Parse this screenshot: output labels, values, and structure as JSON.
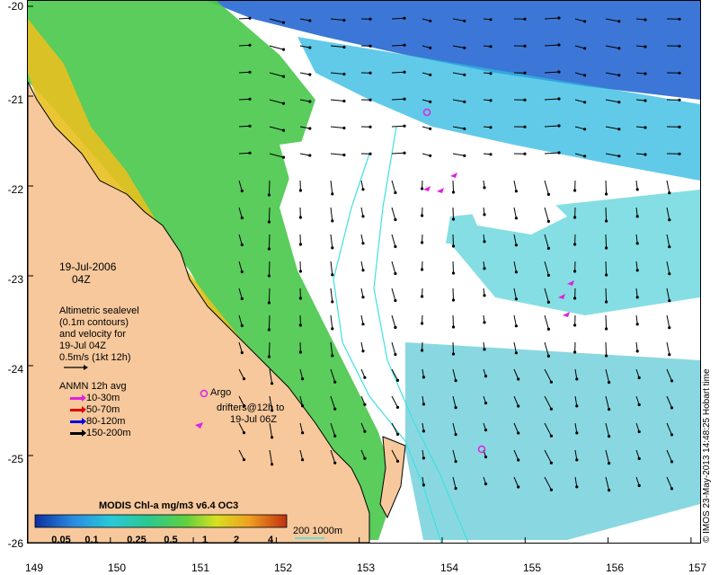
{
  "map": {
    "date_line1": "19-Jul-2006",
    "date_line2": "04Z",
    "lat_labels": [
      "-20",
      "-21",
      "-22",
      "-23",
      "-24",
      "-25",
      "-26"
    ],
    "lon_labels": [
      "149",
      "150",
      "151",
      "152",
      "153",
      "154",
      "155",
      "156",
      "157"
    ],
    "altimetry_text": [
      "Altimetric sealevel",
      "(0.1m contours)",
      "and velocity for",
      "19-Jul 04Z",
      "0.5m/s (1kt 12h)"
    ],
    "anmn_title": "ANMN 12h avg",
    "anmn_items": [
      {
        "label": "10-30m",
        "color": "#e020e0"
      },
      {
        "label": "50-70m",
        "color": "#e00000"
      },
      {
        "label": "80-120m",
        "color": "#0000e0"
      },
      {
        "label": "150-200m",
        "color": "#000000"
      }
    ],
    "argo_label": "Argo",
    "drifters_line1": "drifters@12h to",
    "drifters_line2": "19-Jul 06Z",
    "colorbar_title": "MODIS Chl-a mg/m3 v6.4 OC3",
    "colorbar_ticks": [
      "0.05",
      "0.1",
      "0.25",
      "0.5",
      "1",
      "2",
      "4"
    ],
    "depth_contours_label": "200  1000m",
    "copyright": "© IMOS 23-May-2013 14:48:25 Hobart time",
    "colors": {
      "land": "#f6c89c",
      "coast_contour": "#40e0e0",
      "argo": "#e020e0"
    }
  }
}
